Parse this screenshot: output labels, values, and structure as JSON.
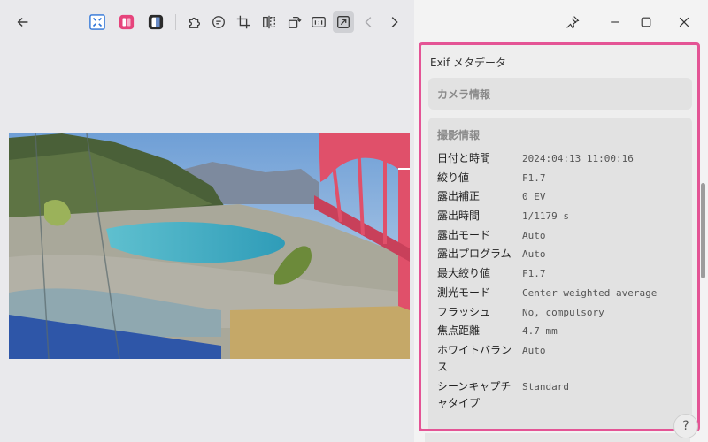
{
  "panel": {
    "title": "Exif メタデータ",
    "camera_card": {
      "title": "カメラ情報"
    },
    "shooting_card": {
      "title": "撮影情報",
      "rows": [
        {
          "label": "日付と時間",
          "value": "2024:04:13 11:00:16"
        },
        {
          "label": "絞り値",
          "value": "F1.7"
        },
        {
          "label": "露出補正",
          "value": "0 EV"
        },
        {
          "label": "露出時間",
          "value": "1/1179 s"
        },
        {
          "label": "露出モード",
          "value": "Auto"
        },
        {
          "label": "露出プログラム",
          "value": "Auto"
        },
        {
          "label": "最大絞り値",
          "value": "F1.7"
        },
        {
          "label": "測光モード",
          "value": "Center weighted average"
        },
        {
          "label": "フラッシュ",
          "value": "No, compulsory"
        },
        {
          "label": "焦点距離",
          "value": "4.7 mm"
        },
        {
          "label": "ホワイトバランス",
          "value": "Auto"
        },
        {
          "label": "シーンキャプチャタイプ",
          "value": "Standard"
        }
      ]
    }
  },
  "help": {
    "label": "?"
  },
  "toolbar": {
    "icons": [
      "back-arrow-icon",
      "fit-screen-icon",
      "filter-app-icon",
      "contrast-app-icon",
      "puzzle-icon",
      "chat-icon",
      "crop-icon",
      "flip-icon",
      "rotate-icon",
      "actual-size-icon",
      "expand-icon",
      "chevron-left-icon",
      "chevron-right-icon"
    ]
  },
  "window": {
    "icons": [
      "pin-icon",
      "minimize-icon",
      "maximize-icon",
      "close-icon"
    ]
  },
  "colors": {
    "highlight_border": "#e45495",
    "bridge": "#e0506a",
    "river": "#3aa7c2"
  }
}
